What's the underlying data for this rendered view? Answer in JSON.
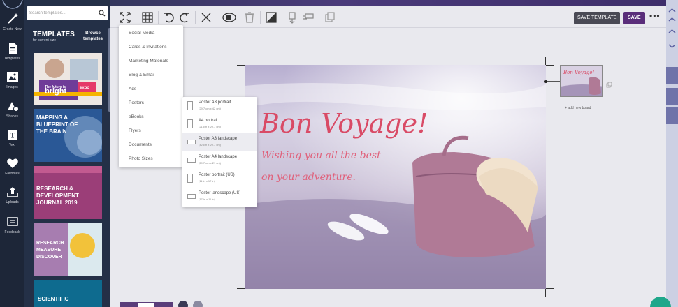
{
  "rail": {
    "items": [
      {
        "label": "Create New",
        "icon": "wand-icon"
      },
      {
        "label": "Templates",
        "icon": "document-icon"
      },
      {
        "label": "Images",
        "icon": "image-icon"
      },
      {
        "label": "Shapes",
        "icon": "shapes-icon"
      },
      {
        "label": "Text",
        "icon": "text-icon"
      },
      {
        "label": "Favorites",
        "icon": "heart-icon"
      },
      {
        "label": "Uploads",
        "icon": "upload-icon"
      },
      {
        "label": "Feedback",
        "icon": "feedback-icon"
      }
    ]
  },
  "panel": {
    "search_placeholder": "Search templates...",
    "title": "TEMPLATES",
    "subtitle": "for current size",
    "browse_label": "Browse templates",
    "thumbs": [
      {
        "text": "bright",
        "extra": "The future is",
        "tag": "expo",
        "bg": "#ffffff"
      },
      {
        "text": "MAPPING A BLUEPRINT OF THE BRAIN",
        "bg": "#1f4a8a"
      },
      {
        "text": "RESEARCH & DEVELOPMENT JOURNAL 2019",
        "bg": "#9a3a72"
      },
      {
        "text": "RESEARCH MEASURE DISCOVER",
        "bg": "#d8e8ee"
      },
      {
        "text": "SCIENTIFIC",
        "bg": "#0e6b8f"
      }
    ]
  },
  "toolbar": {
    "save_template_label": "SAVE TEMPLATE",
    "save_label": "SAVE",
    "more_label": "•••"
  },
  "menu": {
    "items": [
      "Social Media",
      "Cards & Invitations",
      "Marketing Materials",
      "Blog & Email",
      "Ads",
      "Posters",
      "eBooks",
      "Flyers",
      "Documents",
      "Photo Sizes"
    ]
  },
  "submenu": {
    "items": [
      {
        "name": "Poster A3 portrait",
        "dims": "(29.7 cm x 42 cm)",
        "orient": "portrait"
      },
      {
        "name": "A4 portrait",
        "dims": "(21 cm x 29.7 cm)",
        "orient": "portrait"
      },
      {
        "name": "Poster A3 landscape",
        "dims": "(42 cm x 29.7 cm)",
        "orient": "landscape"
      },
      {
        "name": "Poster A4 landscape",
        "dims": "(29.7 cm x 21 cm)",
        "orient": "landscape"
      },
      {
        "name": "Poster portrait (US)",
        "dims": "(11 in x 17 in)",
        "orient": "portrait"
      },
      {
        "name": "Poster landscape (US)",
        "dims": "(17 in x 11 in)",
        "orient": "landscape"
      }
    ]
  },
  "canvas": {
    "headline": "Bon Voyage!",
    "line1": "Wishing you all the best",
    "line2": "on your adventure."
  },
  "board": {
    "thumb_text": "Bon Voyage!",
    "add_label": "+ add new board"
  },
  "colors": {
    "accent": "#5a2d7a",
    "headline": "#d94b66"
  }
}
